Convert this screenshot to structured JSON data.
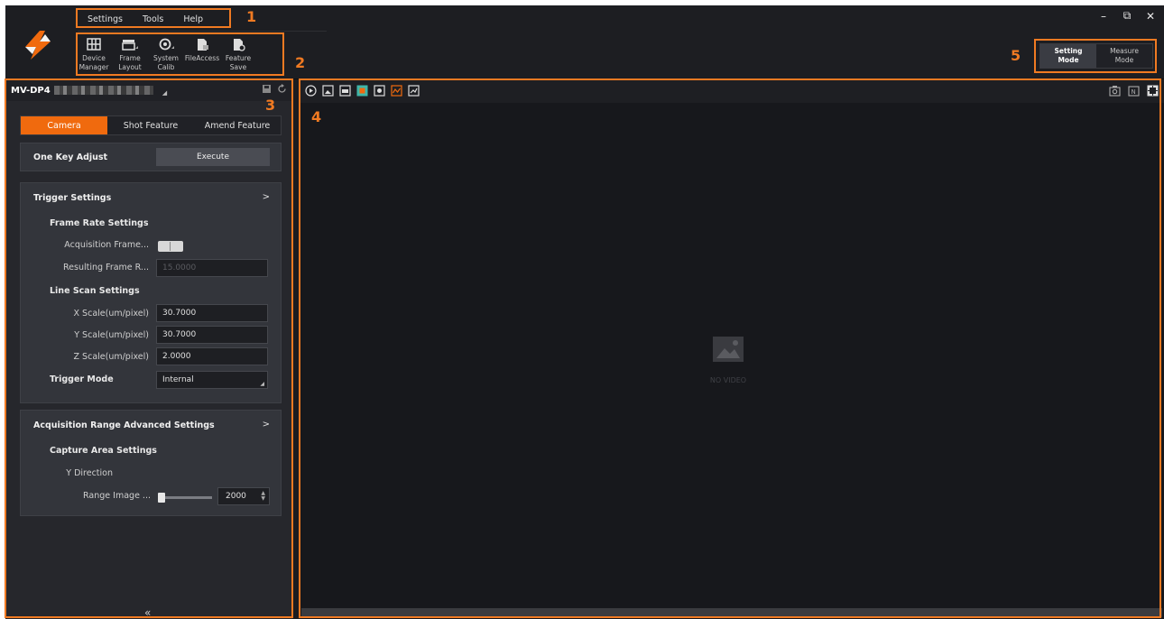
{
  "menu": {
    "items": [
      "Settings",
      "Tools",
      "Help"
    ]
  },
  "toolbar": {
    "items": [
      {
        "label": "Device\nManager",
        "icon": "device-manager-icon"
      },
      {
        "label": "Frame\nLayout",
        "icon": "frame-layout-icon"
      },
      {
        "label": "System\nCalib",
        "icon": "system-calib-icon"
      },
      {
        "label": "FileAccess",
        "icon": "file-access-icon"
      },
      {
        "label": "Feature\nSave",
        "icon": "feature-save-icon"
      }
    ]
  },
  "window_controls": {
    "minimize": "–",
    "restore": "⧉",
    "close": "✕"
  },
  "mode": {
    "setting": "Setting\nMode",
    "measure": "Measure\nMode",
    "active": "setting"
  },
  "device": {
    "name": "MV-DP4"
  },
  "tabs": [
    "Camera",
    "Shot Feature",
    "Amend Feature"
  ],
  "one_key": {
    "label": "One Key Adjust",
    "button": "Execute"
  },
  "trigger": {
    "title": "Trigger Settings",
    "arrow": ">",
    "frame_rate": {
      "title": "Frame Rate Settings",
      "acq_label": "Acquisition Frame...",
      "result_label": "Resulting Frame R...",
      "result_value": "15.0000"
    },
    "line_scan": {
      "title": "Line Scan Settings",
      "x_label": "X Scale(um/pixel)",
      "x_value": "30.7000",
      "y_label": "Y Scale(um/pixel)",
      "y_value": "30.7000",
      "z_label": "Z Scale(um/pixel)",
      "z_value": "2.0000"
    },
    "mode_label": "Trigger Mode",
    "mode_value": "Internal"
  },
  "acq_range": {
    "title": "Acquisition Range Advanced Settings",
    "arrow": ">",
    "capture_title": "Capture Area Settings",
    "direction": "Y Direction",
    "range_label": "Range Image ...",
    "range_value": "2000"
  },
  "collapse": "«",
  "view": {
    "no_video": "NO VIDEO"
  },
  "callouts": [
    "1",
    "2",
    "3",
    "4",
    "5"
  ],
  "colors": {
    "accent": "#f06a0e",
    "callout": "#f07a22",
    "panel": "#26272c",
    "view": "#17181c"
  }
}
